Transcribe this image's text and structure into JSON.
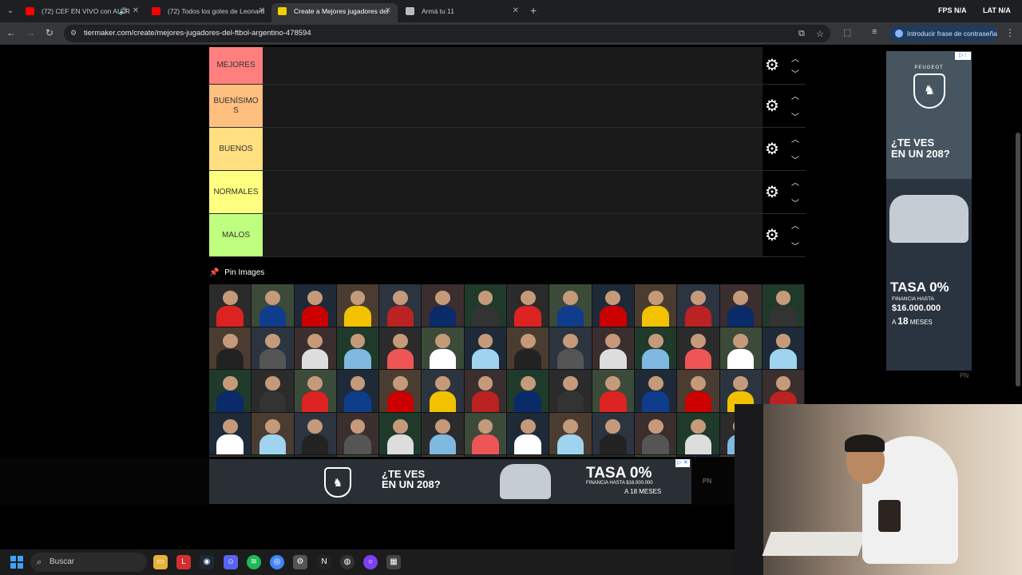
{
  "browser": {
    "tabs": [
      {
        "title": "(72) CEF EN VIVO con ALFR",
        "favicon_color": "#ff0000",
        "active": false,
        "audio": true
      },
      {
        "title": "(72) Todos los goles de Leonard",
        "favicon_color": "#ff0000",
        "active": false,
        "audio": false
      },
      {
        "title": "Create a Mejores jugadores del",
        "favicon_color": "#f5d000",
        "active": true,
        "audio": false
      },
      {
        "title": "Armá tu 11",
        "favicon_color": "#bbbbbb",
        "active": false,
        "audio": false
      }
    ],
    "tray": {
      "fps_label": "FPS",
      "fps_value": "N/A",
      "lat_label": "LAT",
      "lat_value": "N/A"
    },
    "url": "tiermaker.com/create/mejores-jugadores-del-ftbol-argentino-478594",
    "password_chip": "Introducir frase de contraseña"
  },
  "tiers": [
    {
      "label": "MEJORES",
      "color": "#ff7f7f"
    },
    {
      "label": "BUENÍSIMOS",
      "color": "#ffbf7f"
    },
    {
      "label": "BUENOS",
      "color": "#ffdf7f"
    },
    {
      "label": "NORMALES",
      "color": "#ffff7f"
    },
    {
      "label": "MALOS",
      "color": "#bfff7f"
    }
  ],
  "pin_images_label": "Pin Images",
  "ad_right": {
    "brand": "PEUGEOT",
    "headline_1": "¿TE VES",
    "headline_2": "EN UN 208?",
    "rate": "TASA 0%",
    "financing": "FINANCIA HASTA",
    "amount": "$16.000.000",
    "months_prefix": "A",
    "months_number": "18",
    "months_suffix": "MESES",
    "adchoice": "▷ ⁝",
    "pn": "PN"
  },
  "ad_bottom": {
    "headline_1": "¿TE VES",
    "headline_2": "EN UN 208?",
    "rate": "TASA 0%",
    "financing": "FINANCIA HASTA $16.000.000",
    "months": "A 18 MESES",
    "pn": "PN",
    "adchoice": "▷ ✕"
  },
  "taskbar": {
    "search_placeholder": "Buscar"
  }
}
